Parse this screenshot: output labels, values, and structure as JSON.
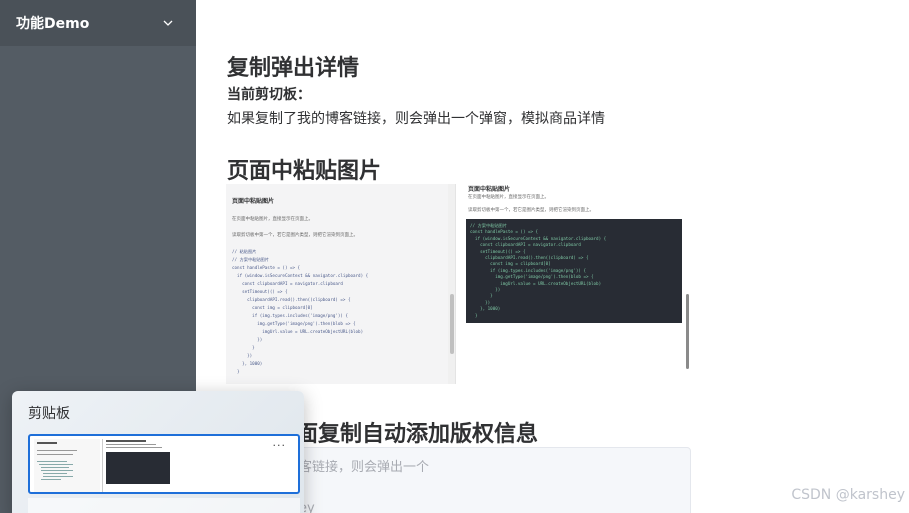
{
  "sidebar": {
    "menu_title": "功能Demo"
  },
  "sections": {
    "copy_popup": {
      "title": "复制弹出详情",
      "clipboard_label": "当前剪切板：",
      "description": "如果复制了我的博客链接，则会弹出一个弹窗，模拟商品详情"
    },
    "paste_image": {
      "title": "页面中粘贴图片"
    },
    "copyright": {
      "title": "面复制自动添加版权信息",
      "textarea_line1": "客链接，则会弹出一个",
      "textarea_line2": "ey"
    }
  },
  "pasted_image_a": {
    "heading": "页面中粘贴图片",
    "line1": "在页面中粘贴图片，直接显示在页面上。",
    "line2": "读取剪切板中第一个，若它是图片类型，则把它渲染到页面上。",
    "code": [
      "// 粘贴图片",
      "// 方案中粘贴图片",
      "const handlePaste = () => {",
      "  if (window.isSecureContext && navigator.clipboard) {",
      "    const clipboardAPI = navigator.clipboard",
      "    setTimeout(() => {",
      "      clipboardAPI.read().then((clipboard) => {",
      "        const img = clipboard[0]",
      "        if (img.types.includes('image/png')) {",
      "          img.getType('image/png').then(blob => {",
      "            imgUrl.value = URL.createObjectURL(blob)",
      "          })",
      "        }",
      "      })",
      "    }, 1000)",
      "  }"
    ]
  },
  "pasted_image_b": {
    "heading": "页面中粘贴图片",
    "line1": "在页面中粘贴图片，直接显示在页面上。",
    "line2": "读取剪切板中第一个，若它是图片类型，则把它渲染到页面上。",
    "code": [
      "// 方案中粘贴图片",
      "const handlePaste = () => {",
      "  if (window.isSecureContext && navigator.clipboard) {",
      "    const clipboardAPI = navigator.clipboard",
      "    setTimeout(() => {",
      "      clipboardAPI.read().then((clipboard) => {",
      "        const img = clipboard[0]",
      "        if (img.types.includes('image/png')) {",
      "          img.getType('image/png').then(blob => {",
      "            imgUrl.value = URL.createObjectURL(blob)",
      "          })",
      "        }",
      "      })",
      "    }, 1000)",
      "  }"
    ]
  },
  "clipboard_panel": {
    "title": "剪贴板",
    "item_menu": "..."
  },
  "watermark": "CSDN @karshey",
  "colors": {
    "sidebar_bg": "#545c64",
    "selection_border": "#1e6fd9",
    "code_bg": "#282c34"
  }
}
